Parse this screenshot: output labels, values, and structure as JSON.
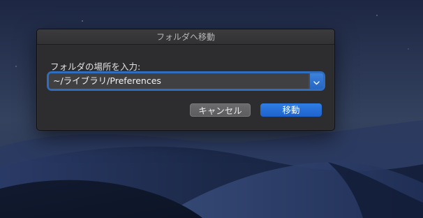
{
  "dialog": {
    "title": "フォルダへ移動",
    "prompt": "フォルダの場所を入力:",
    "path": {
      "value": "~/ライブラリ/Preferences",
      "dropdown_icon": "chevron-down-icon"
    },
    "buttons": {
      "cancel_label": "キャンセル",
      "go_label": "移動"
    }
  },
  "colors": {
    "accent": "#2566c2",
    "dialog_bg": "#2d2d2f"
  }
}
